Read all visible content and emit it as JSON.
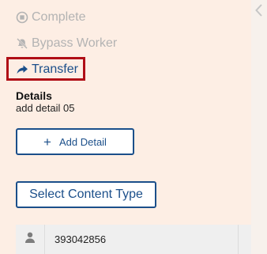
{
  "actions": {
    "complete_label": "Complete",
    "bypass_label": "Bypass Worker",
    "transfer_label": "Transfer"
  },
  "details": {
    "title": "Details",
    "value": "add detail 05",
    "add_button_label": "Add Detail"
  },
  "content_type": {
    "button_label": "Select Content Type"
  },
  "list": {
    "rows": [
      {
        "value": "393042856",
        "icon": "person-icon"
      }
    ]
  },
  "colors": {
    "panel_bg": "#fdeee4",
    "accent": "#1b4f8a",
    "highlight_border": "#b00e16",
    "disabled_text": "#b3b3b3"
  }
}
